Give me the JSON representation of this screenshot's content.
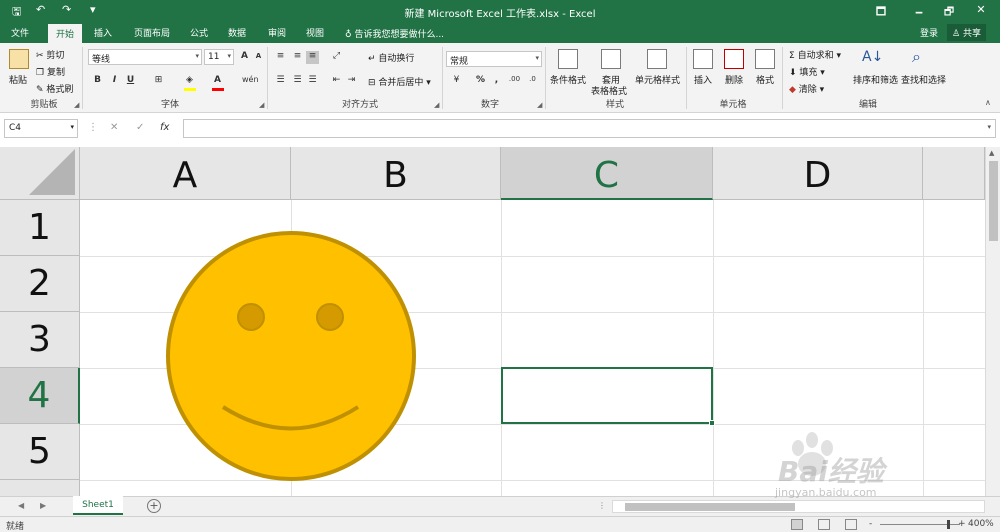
{
  "window": {
    "title": "新建 Microsoft Excel 工作表.xlsx - Excel",
    "minimize": "🗕",
    "restore": "🗗",
    "close": "✕",
    "ribbon_display": "🗖"
  },
  "quick_access": {
    "save": "🖫",
    "undo": "↶",
    "redo": "↷",
    "customize": "▾"
  },
  "tabs": [
    {
      "label": "文件",
      "active": false
    },
    {
      "label": "开始",
      "active": true
    },
    {
      "label": "插入",
      "active": false
    },
    {
      "label": "页面布局",
      "active": false
    },
    {
      "label": "公式",
      "active": false
    },
    {
      "label": "数据",
      "active": false
    },
    {
      "label": "审阅",
      "active": false
    },
    {
      "label": "视图",
      "active": false
    }
  ],
  "tell_me": "告诉我您想要做什么...",
  "login": "登录",
  "share": "共享",
  "ribbon": {
    "clipboard": {
      "label": "剪贴板",
      "paste": "粘贴",
      "cut": "剪切",
      "copy": "复制",
      "format_painter": "格式刷"
    },
    "font": {
      "label": "字体",
      "font_name": "等线",
      "font_size": "11",
      "bold": "B",
      "italic": "I",
      "underline": "U",
      "increase": "A",
      "decrease": "A"
    },
    "alignment": {
      "label": "对齐方式",
      "wrap": "自动换行",
      "merge": "合并后居中"
    },
    "number": {
      "label": "数字",
      "format": "常规",
      "percent": "%",
      "comma": ","
    },
    "styles": {
      "label": "样式",
      "conditional": "条件格式",
      "table_line1": "套用",
      "table_line2": "表格格式",
      "cell_styles": "单元格样式"
    },
    "cells": {
      "label": "单元格",
      "insert": "插入",
      "delete": "删除",
      "format": "格式"
    },
    "editing": {
      "label": "编辑",
      "autosum": "自动求和",
      "fill": "填充",
      "clear": "清除",
      "sort": "排序和筛选",
      "find": "查找和选择"
    }
  },
  "formula_bar": {
    "name_box": "C4",
    "fx": "fx",
    "cancel": "✕",
    "enter": "✓",
    "value": ""
  },
  "grid": {
    "columns": [
      "A",
      "B",
      "C",
      "D"
    ],
    "rows": [
      "1",
      "2",
      "3",
      "4",
      "5"
    ],
    "selected_column": "C",
    "selected_row": "4"
  },
  "sheets": [
    {
      "name": "Sheet1",
      "active": true
    }
  ],
  "add_sheet": "+",
  "status": {
    "text": "就绪",
    "zoom": "400%",
    "zoom_minus": "-",
    "zoom_plus": "+"
  },
  "watermark": {
    "brand": "Bai经验",
    "url": "jingyan.baidu.com"
  },
  "colors": {
    "excel_green": "#217346",
    "smiley_fill": "#ffc000",
    "smiley_stroke": "#bf9000"
  },
  "icons": {
    "smiley": "smiley-face-shape",
    "tell_me": "lightbulb-icon",
    "user": "person-icon"
  }
}
